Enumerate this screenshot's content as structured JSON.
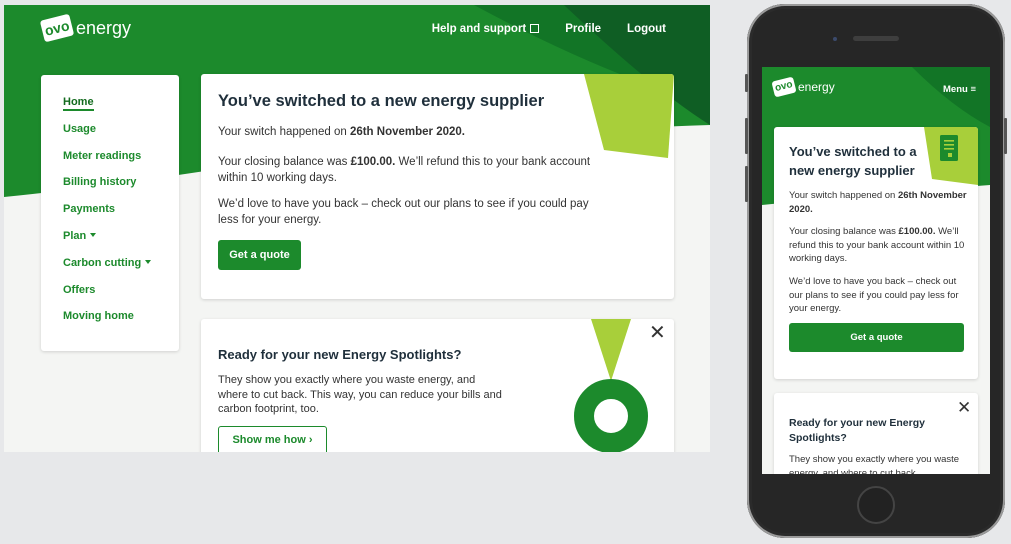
{
  "desktop": {
    "header": {
      "logo": {
        "mark": "ovo",
        "word": "energy"
      },
      "nav": [
        {
          "label": "Help and support",
          "icon": "external-link-icon"
        },
        {
          "label": "Profile"
        },
        {
          "label": "Logout"
        }
      ]
    },
    "sidebar": {
      "items": [
        {
          "label": "Home",
          "active": true,
          "dropdown": false
        },
        {
          "label": "Usage",
          "dropdown": false
        },
        {
          "label": "Meter readings",
          "dropdown": false
        },
        {
          "label": "Billing history",
          "dropdown": false
        },
        {
          "label": "Payments",
          "dropdown": false
        },
        {
          "label": "Plan",
          "dropdown": true
        },
        {
          "label": "Carbon cutting",
          "dropdown": true
        },
        {
          "label": "Offers",
          "dropdown": false
        },
        {
          "label": "Moving home",
          "dropdown": false
        }
      ]
    },
    "switch_card": {
      "title": "You’ve switched to a new energy supplier",
      "switch_prefix": "Your switch happened on ",
      "switch_date": "26th November 2020.",
      "balance_prefix": "Your closing balance was ",
      "balance_amount": "£100.00.",
      "balance_suffix": " We’ll refund this to your bank account within 10 working days.",
      "comeback": "We’d love to have you back – check out our plans to see if you could pay less for your energy.",
      "cta": "Get a quote"
    },
    "spotlight_card": {
      "title": "Ready for your new Energy Spotlights?",
      "body": "They show you exactly where you waste energy, and where to cut back. This way, you can reduce your bills and carbon footprint, too.",
      "cta": "Show me how",
      "close": "✕"
    }
  },
  "mobile": {
    "header": {
      "logo": {
        "mark": "ovo",
        "word": "energy"
      },
      "menu": "Menu ≡"
    },
    "switch_card": {
      "title": "You’ve switched to a new energy supplier",
      "switch_prefix": "Your switch happened on ",
      "switch_date": "26th November 2020.",
      "balance_prefix": "Your closing balance was ",
      "balance_amount": "£100.00.",
      "balance_suffix": " We’ll refund this to your bank account within 10 working days.",
      "comeback": "We’d love to have you back – check out our plans to see if you could pay less for your energy.",
      "cta": "Get a quote"
    },
    "spotlight_card": {
      "title": "Ready for your new Energy Spotlights?",
      "body": "They show you exactly where you waste energy, and where to cut back.",
      "close": "✕"
    }
  },
  "colors": {
    "brand_green": "#1c8a2c",
    "dark_green": "#0f5e24",
    "lime": "#a8cf3a",
    "page_bg": "#e7e8ea"
  }
}
